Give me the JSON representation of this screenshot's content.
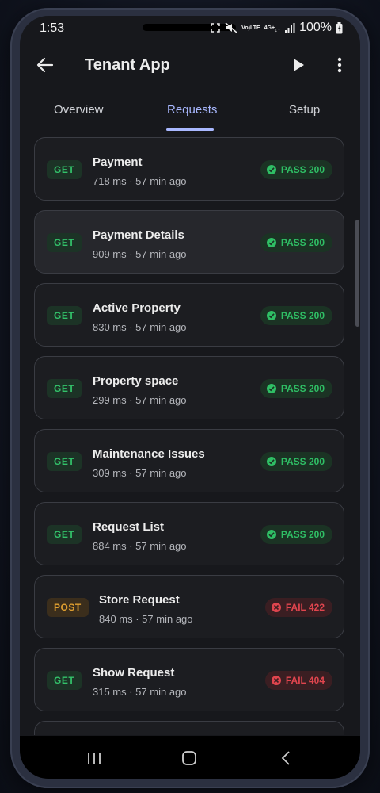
{
  "status_bar": {
    "time": "1:53",
    "network_top": "Vo)",
    "network_bottom": "LTE",
    "network2_top": "4G+",
    "battery": "100%"
  },
  "app_bar": {
    "title": "Tenant App",
    "icons": [
      "arrow-back-icon",
      "play-icon",
      "more-vert-icon"
    ]
  },
  "tabs": {
    "overview": "Overview",
    "requests": "Requests",
    "setup": "Setup",
    "active": "Requests"
  },
  "requests": [
    {
      "method": "GET",
      "name": "Payment",
      "meta": "718 ms · 57 min ago",
      "status": "PASS 200"
    },
    {
      "method": "GET",
      "name": "Payment Details",
      "meta": "909 ms · 57 min ago",
      "status": "PASS 200"
    },
    {
      "method": "GET",
      "name": "Active Property",
      "meta": "830 ms · 57 min ago",
      "status": "PASS 200"
    },
    {
      "method": "GET",
      "name": "Property space",
      "meta": "299 ms · 57 min ago",
      "status": "PASS 200"
    },
    {
      "method": "GET",
      "name": "Maintenance Issues",
      "meta": "309 ms · 57 min ago",
      "status": "PASS 200"
    },
    {
      "method": "GET",
      "name": "Request List",
      "meta": "884 ms · 57 min ago",
      "status": "PASS 200"
    },
    {
      "method": "POST",
      "name": "Store Request",
      "meta": "840 ms · 57 min ago",
      "status": "FAIL 422"
    },
    {
      "method": "GET",
      "name": "Show Request",
      "meta": "315 ms · 57 min ago",
      "status": "FAIL 404"
    }
  ],
  "colors": {
    "accent": "#a9b8ff",
    "pass": "#2fbf65",
    "fail": "#e0454e",
    "post": "#e0a030"
  }
}
